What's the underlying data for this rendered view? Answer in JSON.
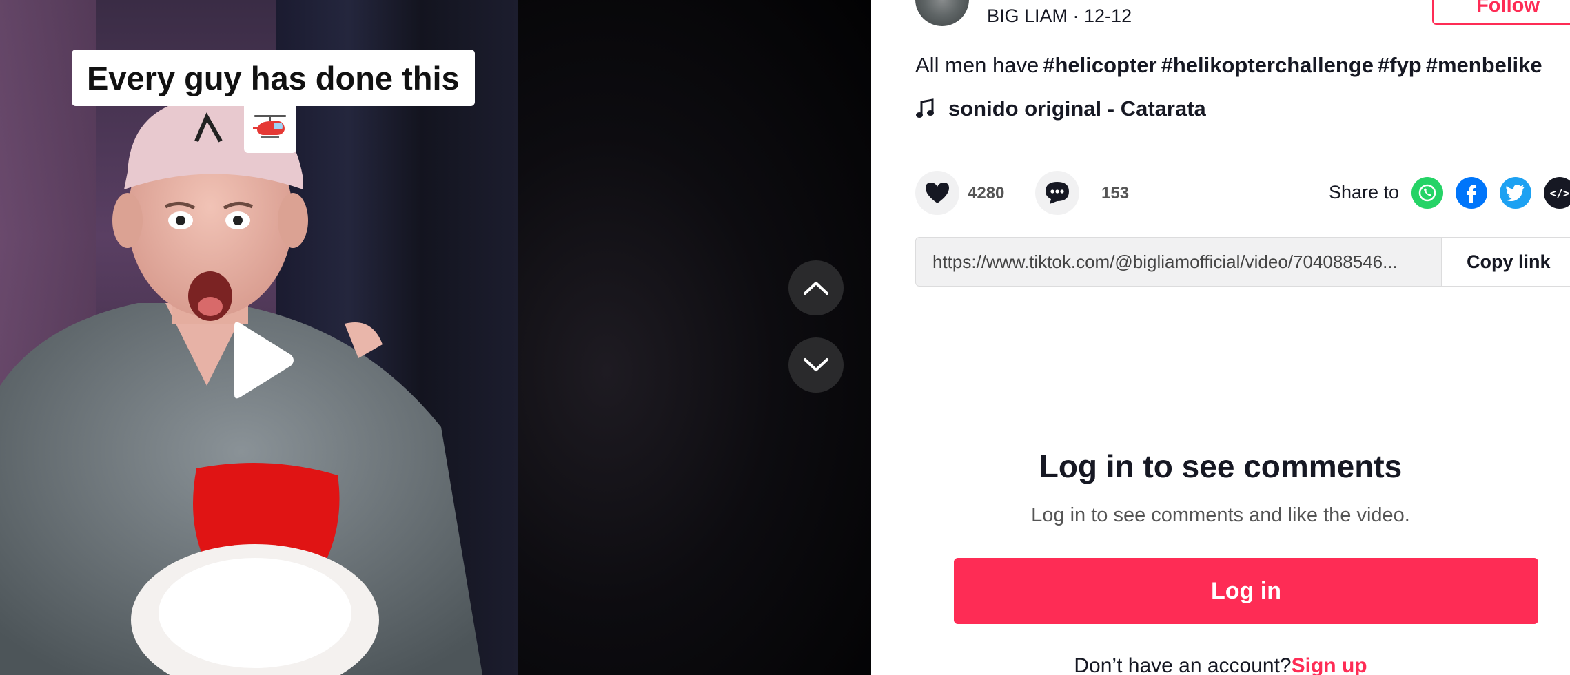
{
  "video": {
    "caption": "Every guy has done this",
    "caption_emoji": "🚁",
    "play_icon": "play-icon",
    "nav_prev_icon": "chevron-up-icon",
    "nav_next_icon": "chevron-down-icon"
  },
  "author": {
    "line": "BIG LIAM · 12-12",
    "follow_label": "Follow"
  },
  "description": {
    "text": "All men have",
    "hashtags": [
      "#helicopter",
      "#helikopterchallenge",
      "#fyp",
      "#menbelike"
    ]
  },
  "sound": {
    "icon": "music-note-icon",
    "label": "sonido original - Catarata"
  },
  "actions": {
    "likes": "4280",
    "comments": "153",
    "share_label": "Share to",
    "share_icons": [
      "whatsapp-icon",
      "facebook-icon",
      "twitter-icon",
      "embed-icon"
    ],
    "embed_glyph": "</>"
  },
  "link": {
    "url": "https://www.tiktok.com/@bigliamofficial/video/704088546...",
    "copy_label": "Copy link"
  },
  "login": {
    "title": "Log in to see comments",
    "subtitle": "Log in to see comments and like the video.",
    "button_label": "Log in",
    "signup_prompt": "Don’t have an account?",
    "signup_link": "Sign up"
  },
  "colors": {
    "accent": "#fe2c55",
    "text": "#161823",
    "whatsapp": "#25d366",
    "facebook": "#0075fa",
    "twitter": "#1da1f2"
  }
}
